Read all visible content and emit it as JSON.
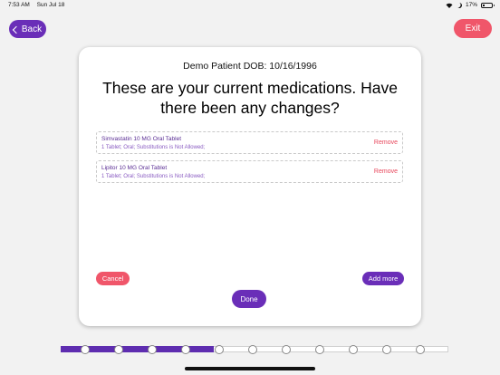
{
  "status_bar": {
    "time": "7:53 AM",
    "date": "Sun Jul 18",
    "battery": "17%"
  },
  "nav": {
    "back_label": "Back",
    "exit_label": "Exit"
  },
  "card": {
    "patient_line": "Demo Patient DOB: 10/16/1996",
    "question": "These are your current medications. Have there been any changes?",
    "medications": [
      {
        "name": "Simvastatin 10 MG Oral Tablet",
        "detail": "1 Tablet; Oral; Substitutions is Not Allowed;",
        "remove_label": "Remove"
      },
      {
        "name": "Lipitor 10 MG Oral Tablet",
        "detail": "1 Tablet; Oral; Substitutions is Not Allowed;",
        "remove_label": "Remove"
      }
    ],
    "cancel_label": "Cancel",
    "add_more_label": "Add more",
    "done_label": "Done"
  },
  "progress": {
    "total_steps": 11,
    "filled_fraction": 0.395
  },
  "colors": {
    "primary": "#6a2eb8",
    "danger": "#f0566a",
    "progress_fill": "#5e2db0"
  }
}
